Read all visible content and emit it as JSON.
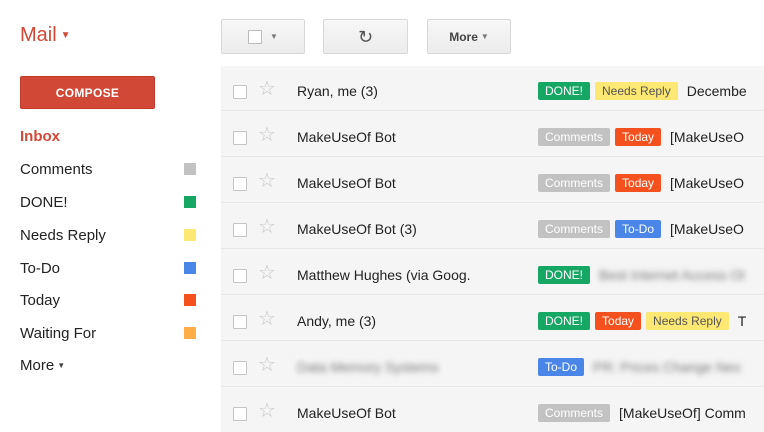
{
  "app": {
    "title": "Mail"
  },
  "toolbar": {
    "more_label": "More"
  },
  "compose": {
    "label": "COMPOSE"
  },
  "sidebar": {
    "inbox": "Inbox",
    "labels": [
      {
        "name": "Comments",
        "color": "#c2c2c2"
      },
      {
        "name": "DONE!",
        "color": "#16a765"
      },
      {
        "name": "Needs Reply",
        "color": "#fce873"
      },
      {
        "name": "To-Do",
        "color": "#4a86e8"
      },
      {
        "name": "Today",
        "color": "#f4511e"
      },
      {
        "name": "Waiting For",
        "color": "#ffad46"
      }
    ],
    "more": "More"
  },
  "label_colors": {
    "done": "#16a765",
    "today": "#f4511e",
    "comments": "#c2c2c2",
    "todo": "#4a86e8",
    "needs": "#fce873"
  },
  "messages": [
    {
      "sender": "Ryan, me (3)",
      "labels": [
        {
          "text": "DONE!",
          "kind": "done"
        },
        {
          "text": "Needs Reply",
          "kind": "needs"
        }
      ],
      "subject": "Decembe"
    },
    {
      "sender": "MakeUseOf Bot",
      "labels": [
        {
          "text": "Comments",
          "kind": "comments"
        },
        {
          "text": "Today",
          "kind": "today"
        }
      ],
      "subject": "[MakeUseO"
    },
    {
      "sender": "MakeUseOf Bot",
      "labels": [
        {
          "text": "Comments",
          "kind": "comments"
        },
        {
          "text": "Today",
          "kind": "today"
        }
      ],
      "subject": "[MakeUseO"
    },
    {
      "sender": "MakeUseOf Bot (3)",
      "labels": [
        {
          "text": "Comments",
          "kind": "comments"
        },
        {
          "text": "To-Do",
          "kind": "todo"
        }
      ],
      "subject": "[MakeUseO"
    },
    {
      "sender": "Matthew Hughes (via Goog.",
      "labels": [
        {
          "text": "DONE!",
          "kind": "done"
        }
      ],
      "subject": "Best Internet Access Ol",
      "subject_blurred": true
    },
    {
      "sender": "Andy, me (3)",
      "labels": [
        {
          "text": "DONE!",
          "kind": "done"
        },
        {
          "text": "Today",
          "kind": "today"
        },
        {
          "text": "Needs Reply",
          "kind": "needs"
        }
      ],
      "subject": "T"
    },
    {
      "sender": "Data Memory Systems",
      "sender_blurred": true,
      "labels": [
        {
          "text": "To-Do",
          "kind": "todo"
        }
      ],
      "subject": "PR: Prices Change Nex",
      "subject_blurred": true
    },
    {
      "sender": "MakeUseOf Bot",
      "labels": [
        {
          "text": "Comments",
          "kind": "comments"
        }
      ],
      "subject": "[MakeUseOf] Comm"
    }
  ]
}
